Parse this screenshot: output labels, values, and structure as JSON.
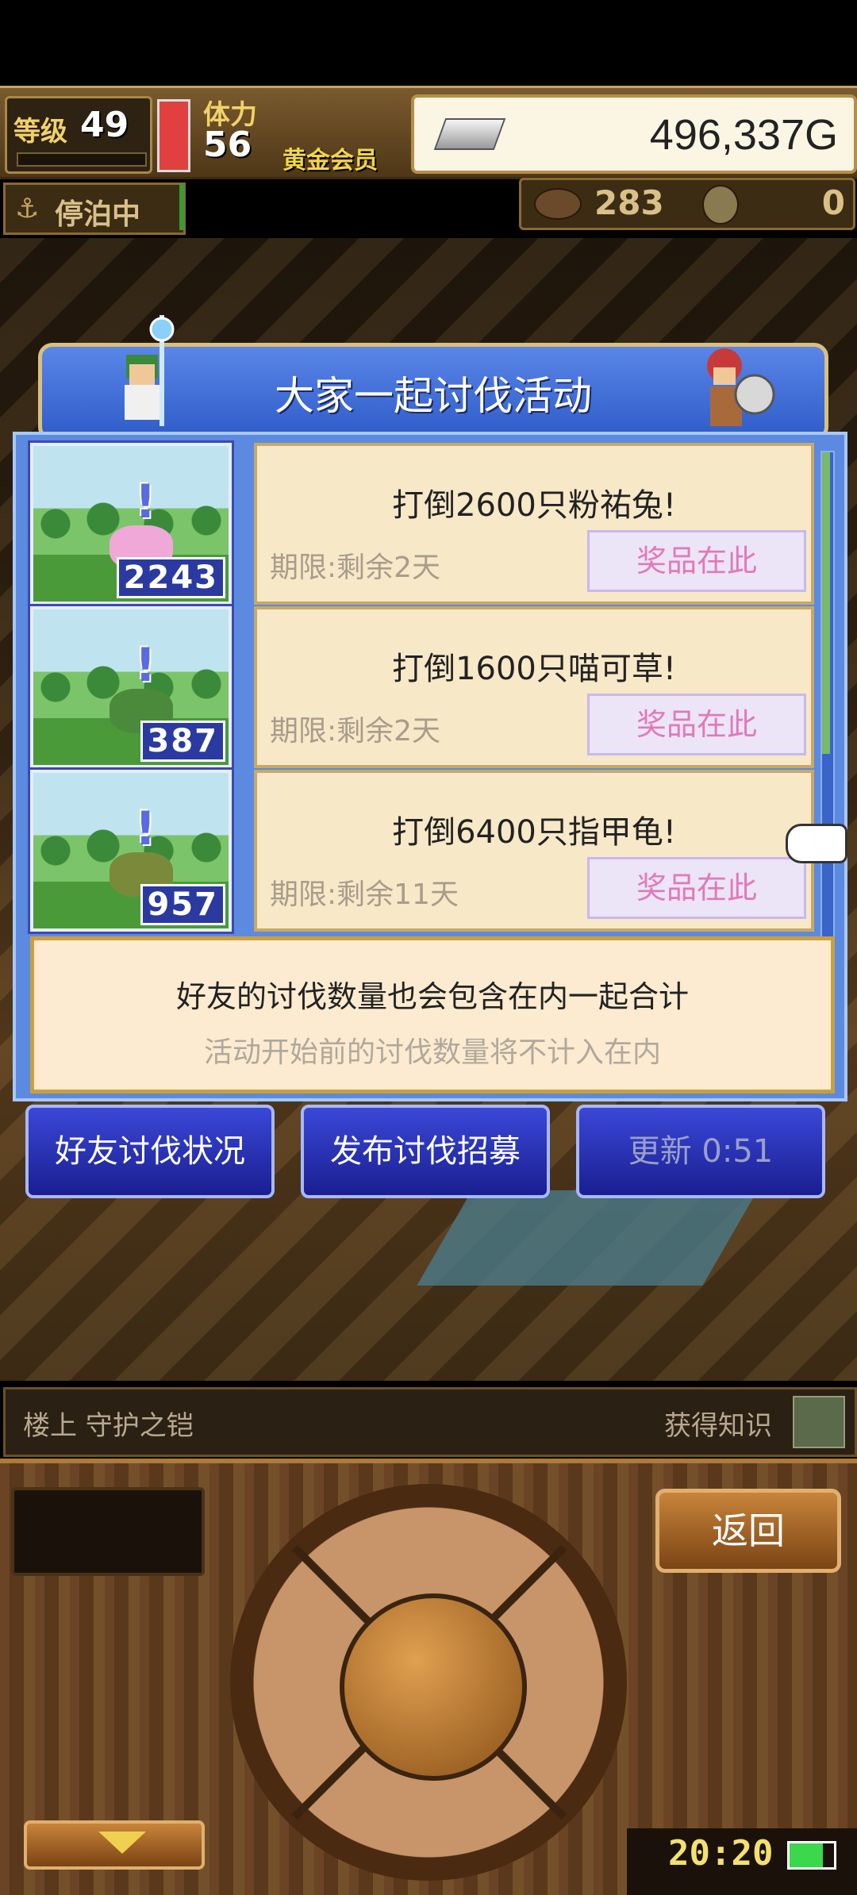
{
  "hud": {
    "level_label": "等级",
    "level_value": "49",
    "stamina_label": "体力",
    "stamina_value": "56",
    "membership": "黄金会员",
    "gold": "496,337G",
    "status": "停泊中",
    "resource_1": "283",
    "resource_2": "0"
  },
  "dialog": {
    "title": "大家一起讨伐活动",
    "quests": [
      {
        "title": "打倒2600只粉祐兔!",
        "deadline": "期限:剩余2天",
        "reward_label": "奖品在此",
        "count": "2243",
        "monster_icon": "pink-rabbit-icon"
      },
      {
        "title": "打倒1600只喵可草!",
        "deadline": "期限:剩余2天",
        "reward_label": "奖品在此",
        "count": "387",
        "monster_icon": "grass-monster-icon"
      },
      {
        "title": "打倒6400只指甲龟!",
        "deadline": "期限:剩余11天",
        "reward_label": "奖品在此",
        "count": "957",
        "monster_icon": "turtle-icon"
      }
    ],
    "info_main": "好友的讨伐数量也会包含在内一起合计",
    "info_sub": "活动开始前的讨伐数量将不计入在内",
    "buttons": {
      "friend_status": "好友讨伐状况",
      "post_recruit": "发布讨伐招募",
      "refresh": "更新 0:51"
    }
  },
  "bottom": {
    "floor": "楼上 守护之铠",
    "knowledge": "获得知识",
    "back": "返回",
    "clock": "20:20",
    "battery_level": 0.75
  },
  "colors": {
    "dialog_blue": "#5b8ae0",
    "card_bg": "#f7e8c8",
    "reward_text": "#e07ab8",
    "gold_text": "#f3d64a"
  }
}
